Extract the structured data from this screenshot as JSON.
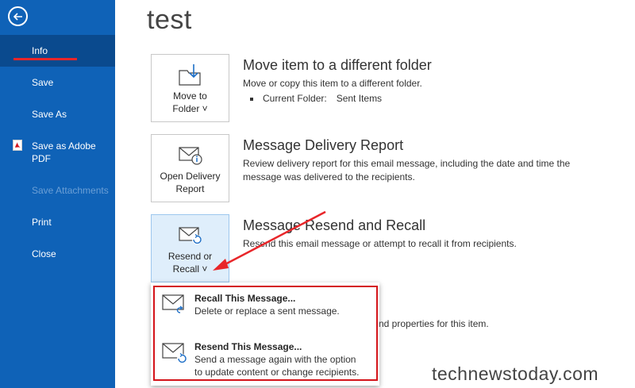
{
  "sidebar": {
    "items": [
      {
        "label": "Info"
      },
      {
        "label": "Save"
      },
      {
        "label": "Save As"
      },
      {
        "label": "Save as Adobe PDF"
      },
      {
        "label": "Save Attachments"
      },
      {
        "label": "Print"
      },
      {
        "label": "Close"
      }
    ],
    "save_pdf_line1": "Save as Adobe",
    "save_pdf_line2": "PDF"
  },
  "page": {
    "title": "test"
  },
  "sections": {
    "move": {
      "tile_line1": "Move to",
      "tile_line2": "Folder ˅",
      "title": "Move item to a different folder",
      "desc": "Move or copy this item to a different folder.",
      "folder_label": "Current Folder:",
      "folder_value": "Sent Items"
    },
    "delivery": {
      "tile_line1": "Open Delivery",
      "tile_line2": "Report",
      "title": "Message Delivery Report",
      "desc": "Review delivery report for this email message, including the date and time the message was delivered to the recipients."
    },
    "resend": {
      "tile_line1": "Resend or",
      "tile_line2": "Recall ˅",
      "title": "Message Resend and Recall",
      "desc": "Resend this email message or attempt to recall it from recipients."
    },
    "hidden_desc": "nd properties for this item."
  },
  "dropdown": {
    "recall": {
      "title": "Recall This Message...",
      "desc": "Delete or replace a sent message."
    },
    "resend": {
      "title": "Resend This Message...",
      "desc_line1": "Send a message again with the option",
      "desc_line2": "to update content or change recipients."
    }
  },
  "watermark": "technewstoday.com",
  "colors": {
    "sidebar": "#0f62b7",
    "sidebar_active": "#0a4a8e",
    "highlight": "#d4141a",
    "arrow": "#e8262a"
  }
}
